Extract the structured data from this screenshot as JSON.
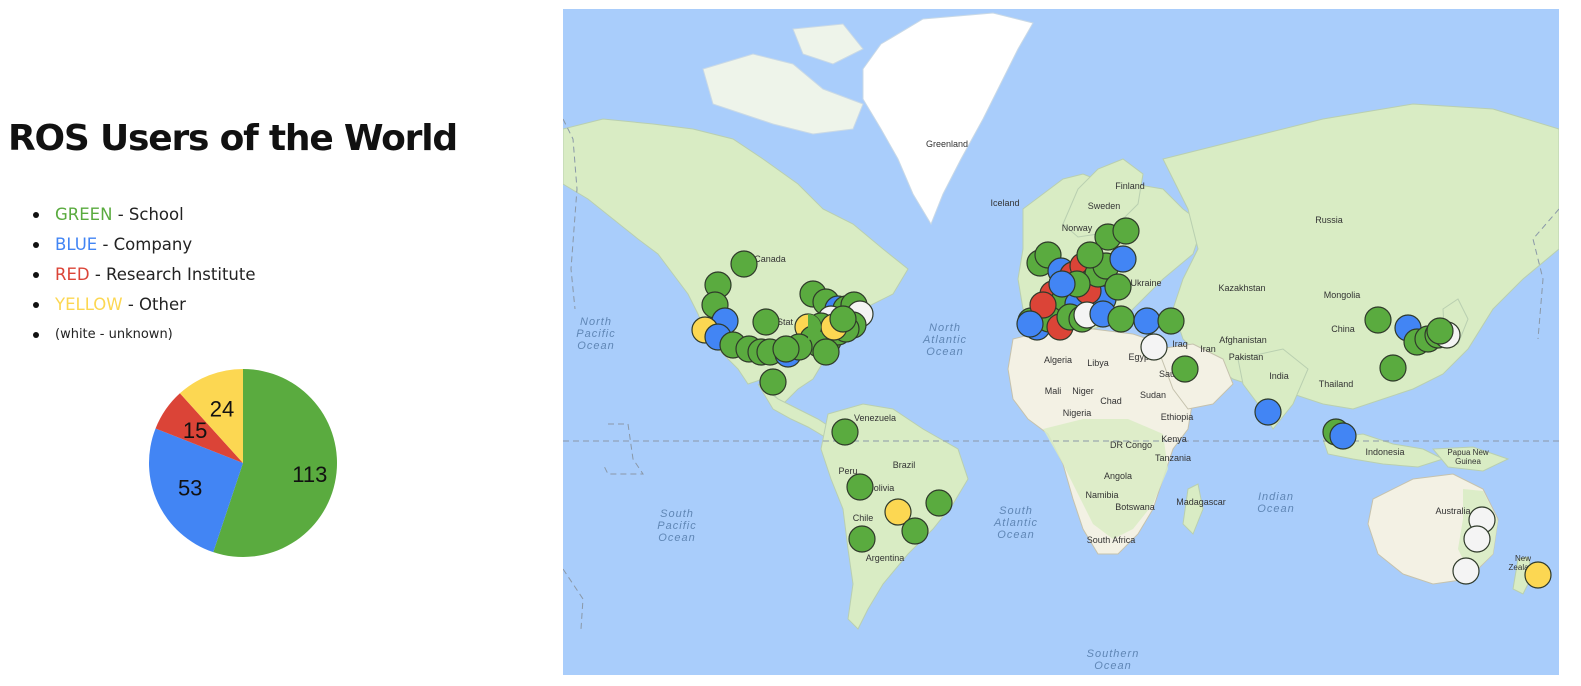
{
  "title": "ROS Users of the World",
  "legend": [
    {
      "color_word": "GREEN",
      "desc": " - School",
      "color": "#5aab3f"
    },
    {
      "color_word": "BLUE",
      "desc": " - Company",
      "color": "#4285f4"
    },
    {
      "color_word": "RED",
      "desc": " - Research Institute",
      "color": "#db4437"
    },
    {
      "color_word": "YELLOW",
      "desc": " - Other",
      "color": "#fcd752"
    },
    {
      "text": "(white - unknown)"
    }
  ],
  "chart_data": {
    "type": "pie",
    "title": "",
    "slices": [
      {
        "label": "GREEN - School",
        "value": 113,
        "color": "#5aab3f"
      },
      {
        "label": "BLUE - Company",
        "value": 53,
        "color": "#4285f4"
      },
      {
        "label": "RED - Research Institute",
        "value": 15,
        "color": "#db4437"
      },
      {
        "label": "YELLOW - Other",
        "value": 24,
        "color": "#fcd752"
      }
    ]
  },
  "map": {
    "labels": {
      "greenland": "Greenland",
      "iceland": "Iceland",
      "canada": "Canada",
      "finland": "Finland",
      "sweden": "Sweden",
      "norway": "Norway",
      "russia": "Russia",
      "ukraine": "Ukraine",
      "kazakhstan": "Kazakhstan",
      "mongolia": "Mongolia",
      "china": "China",
      "afghanistan": "Afghanistan",
      "pakistan": "Pakistan",
      "iran": "Iran",
      "iraq": "Iraq",
      "india": "India",
      "thailand": "Thailand",
      "indonesia": "Indonesia",
      "papua": "Papua New Guinea",
      "australia": "Australia",
      "new_zealand": "New Zealand",
      "algeria": "Algeria",
      "libya": "Libya",
      "egypt": "Egypt",
      "mali": "Mali",
      "niger": "Niger",
      "chad": "Chad",
      "sudan": "Sudan",
      "nigeria": "Nigeria",
      "ethiopia": "Ethiopia",
      "kenya": "Kenya",
      "dr_congo": "DR Congo",
      "tanzania": "Tanzania",
      "angola": "Angola",
      "namibia": "Namibia",
      "botswana": "Botswana",
      "madagascar": "Madagascar",
      "south_africa": "South Africa",
      "venezuela": "Venezuela",
      "brazil": "Brazil",
      "peru": "Peru",
      "bolivia": "Bolivia",
      "chile": "Chile",
      "argentina": "Argentina",
      "usa_partial": "Stat",
      "saudi": "Sau",
      "north_pacific": "North Pacific Ocean",
      "north_atlantic": "North Atlantic Ocean",
      "south_pacific": "South Pacific Ocean",
      "south_atlantic": "South Atlantic Ocean",
      "indian_ocean": "Indian Ocean",
      "southern_ocean": "Southern Ocean"
    },
    "colors": {
      "water": "#a9cdfb",
      "land": "#d9ecc4",
      "desert": "#f3f1e4",
      "ice": "#ffffff",
      "school": "#5aab3f",
      "company": "#4285f4",
      "research": "#db4437",
      "other": "#fcd752",
      "unknown": "#f4f4f4"
    }
  }
}
